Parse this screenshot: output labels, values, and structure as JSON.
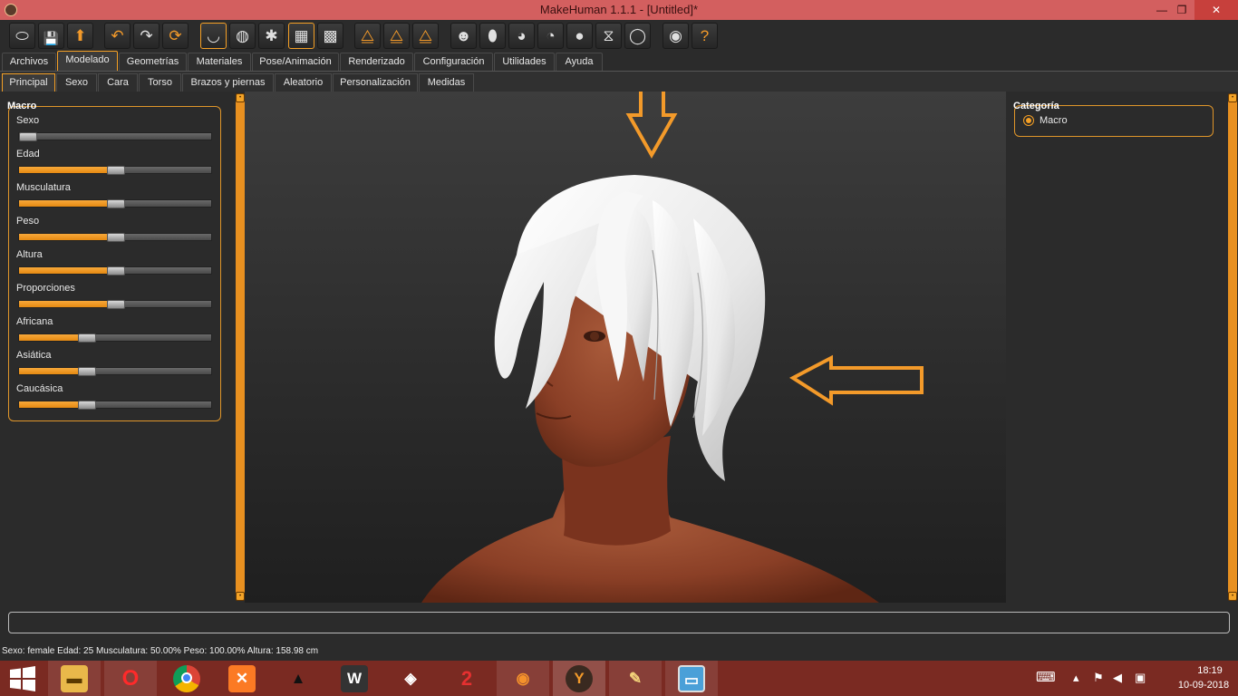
{
  "window": {
    "title": "MakeHuman 1.1.1 - [Untitled]*",
    "minimize_glyph": "—",
    "maximize_glyph": "❐",
    "close_glyph": "✕"
  },
  "toolbar": {
    "icons": [
      "new-icon",
      "save-icon",
      "export-icon",
      "undo-icon",
      "redo-icon",
      "reset-icon",
      "smooth-icon",
      "wireframe-icon",
      "pose-icon",
      "grid-icon",
      "checker-icon",
      "symmetry-right-icon",
      "symmetry-left-icon",
      "symmetry-icon",
      "front-view-icon",
      "back-view-icon",
      "left-view-icon",
      "right-view-icon",
      "top-view-icon",
      "bottom-view-icon",
      "reset-camera-icon",
      "screenshot-icon",
      "help-icon"
    ]
  },
  "main_tabs": [
    "Archivos",
    "Modelado",
    "Geometrías",
    "Materiales",
    "Pose/Animación",
    "Renderizado",
    "Configuración",
    "Utilidades",
    "Ayuda"
  ],
  "sub_tabs": [
    "Principal",
    "Sexo",
    "Cara",
    "Torso",
    "Brazos y piernas",
    "Aleatorio",
    "Personalización",
    "Medidas"
  ],
  "left_panel": {
    "group_title": "Macro",
    "sliders": [
      {
        "label": "Sexo",
        "value": 0.0
      },
      {
        "label": "Edad",
        "value": 0.5
      },
      {
        "label": "Musculatura",
        "value": 0.5
      },
      {
        "label": "Peso",
        "value": 0.5
      },
      {
        "label": "Altura",
        "value": 0.5
      },
      {
        "label": "Proporciones",
        "value": 0.5
      },
      {
        "label": "Africana",
        "value": 0.333
      },
      {
        "label": "Asiática",
        "value": 0.333
      },
      {
        "label": "Caucásica",
        "value": 0.333
      }
    ]
  },
  "right_panel": {
    "group_title": "Categoría",
    "radio_label": "Macro"
  },
  "status": {
    "text": "Sexo: female Edad: 25 Musculatura: 50.00% Peso: 100.00% Altura: 158.98 cm"
  },
  "colors": {
    "accent": "#f5a025",
    "titlebar": "#d35f5f",
    "taskbar": "#7a2a22",
    "skin": "#8a3f26",
    "hair": "#f0f0f0"
  },
  "taskbar": {
    "apps": [
      "file-explorer-icon",
      "opera-icon",
      "chrome-icon",
      "xampp-icon",
      "inkscape-icon",
      "world-of-tanks-icon",
      "unity-icon",
      "app-2-icon",
      "blender-icon",
      "makehuman-icon",
      "paint-icon",
      "photos-icon"
    ],
    "time": "18:19",
    "date": "10-09-2018"
  }
}
